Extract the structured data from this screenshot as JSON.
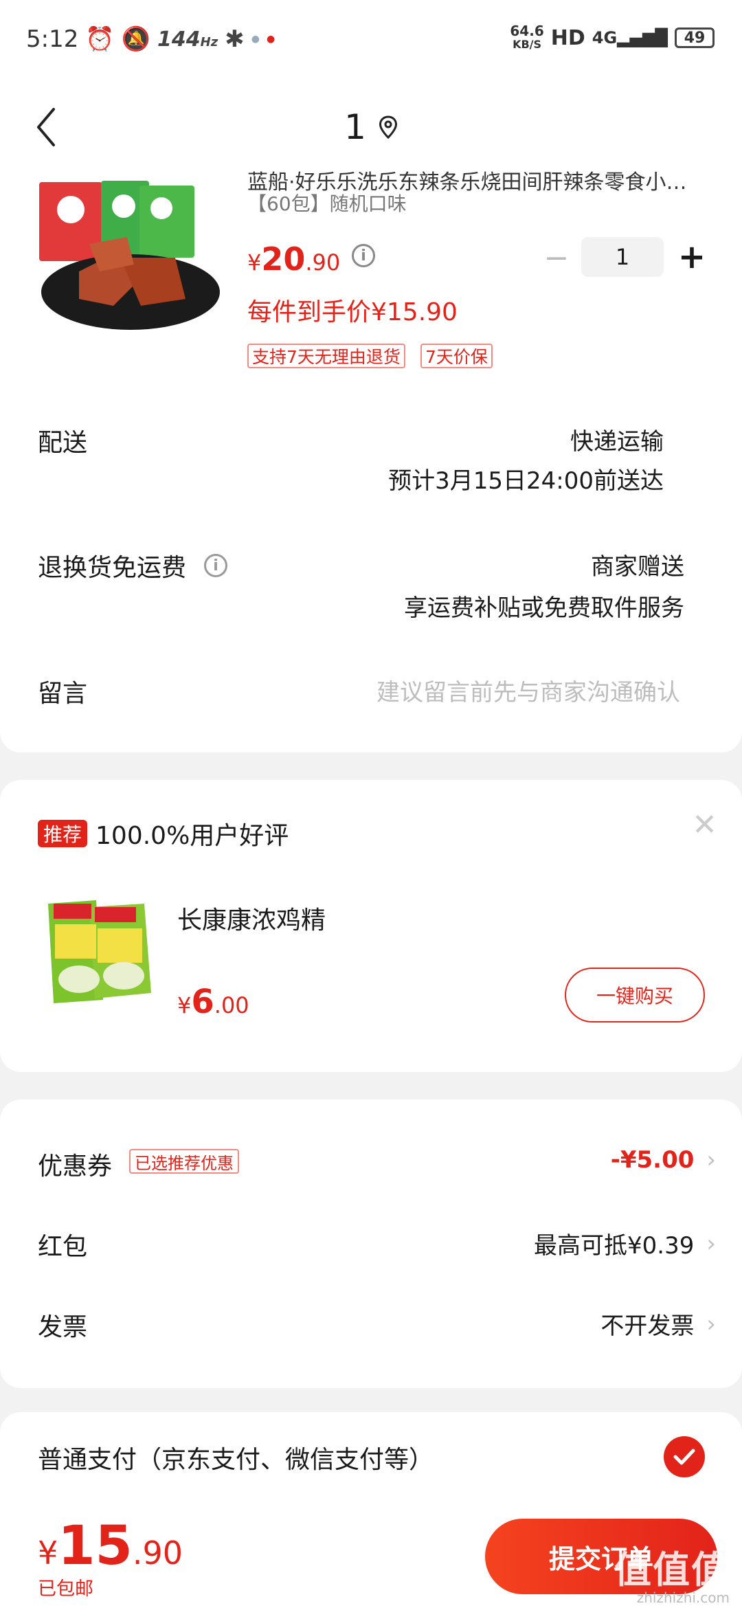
{
  "status_bar": {
    "time": "5:12",
    "refresh_rate": "144",
    "refresh_unit": "Hz",
    "net_speed": "64.6",
    "net_unit": "KB/S",
    "hd": "HD",
    "signal": "4G",
    "battery": "49"
  },
  "nav": {
    "title": "1"
  },
  "product": {
    "title": "蓝船·好乐乐洗乐东辣条乐烧田间肝辣条零食小…",
    "spec": "【60包】随机口味",
    "price_currency": "¥",
    "price_int": "20",
    "price_dec": ".90",
    "final_price": "每件到手价¥15.90",
    "quantity": "1",
    "tags": [
      "支持7天无理由退货",
      "7天价保"
    ]
  },
  "delivery": {
    "label": "配送",
    "method": "快递运输",
    "eta": "预计3月15日24:00前送达"
  },
  "return": {
    "label": "退换货免运费",
    "value": "商家赠送",
    "desc": "享运费补贴或免费取件服务"
  },
  "message": {
    "label": "留言",
    "placeholder": "建议留言前先与商家沟通确认"
  },
  "recommend": {
    "badge": "推荐",
    "rating": "100.0%用户好评",
    "name": "长康康浓鸡精",
    "price_currency": "¥",
    "price_int": "6",
    "price_dec": ".00",
    "button": "一键购买"
  },
  "discounts": {
    "coupon_label": "优惠券",
    "coupon_tag": "已选推荐优惠",
    "coupon_value": "-¥5.00",
    "redpacket_label": "红包",
    "redpacket_value": "最高可抵¥0.39",
    "invoice_label": "发票",
    "invoice_value": "不开发票"
  },
  "payment": {
    "method": "普通支付（京东支付、微信支付等）"
  },
  "footer": {
    "total_currency": "¥",
    "total_int": "15",
    "total_dec": ".90",
    "shipping": "已包邮",
    "submit": "提交订单",
    "watermark": "值值值",
    "watermark_url": "zhizhizhi.com"
  },
  "colors": {
    "accent": "#e2231a",
    "background": "#f2f2f2"
  }
}
